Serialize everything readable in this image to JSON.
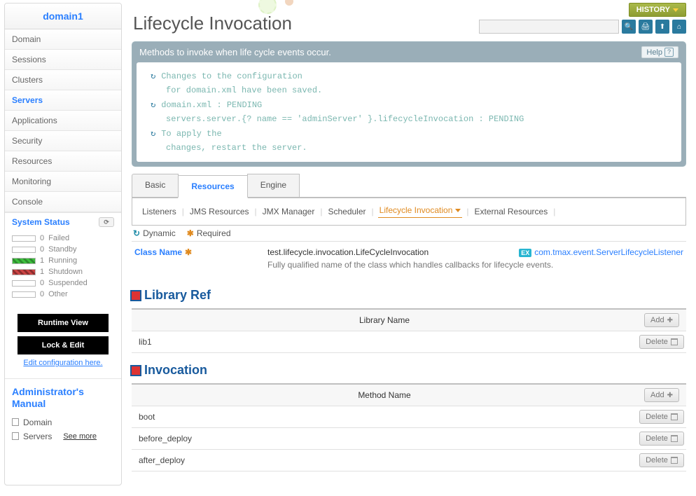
{
  "sidebar": {
    "title": "domain1",
    "items": [
      "Domain",
      "Sessions",
      "Clusters",
      "Servers",
      "Applications",
      "Security",
      "Resources",
      "Monitoring",
      "Console"
    ],
    "selectedIndex": 3,
    "systemStatusLabel": "System Status",
    "statuses": [
      {
        "count": "0",
        "label": "Failed",
        "swatch": ""
      },
      {
        "count": "0",
        "label": "Standby",
        "swatch": ""
      },
      {
        "count": "1",
        "label": "Running",
        "swatch": "green"
      },
      {
        "count": "1",
        "label": "Shutdown",
        "swatch": "red"
      },
      {
        "count": "0",
        "label": "Suspended",
        "swatch": ""
      },
      {
        "count": "0",
        "label": "Other",
        "swatch": ""
      }
    ],
    "runtimeBtn": "Runtime View",
    "lockBtn": "Lock & Edit",
    "editLink": "Edit configuration here.",
    "manualTitle": "Administrator's Manual",
    "manualItems": [
      "Domain",
      "Servers"
    ],
    "seeMore": "See more"
  },
  "header": {
    "historyBtn": "HISTORY",
    "pageTitle": "Lifecycle Invocation"
  },
  "messageBox": {
    "heading": "Methods to invoke when life cycle events occur.",
    "helpLabel": "Help",
    "lines": [
      "Changes to the configuration",
      "for domain.xml have been saved.",
      "domain.xml : PENDING",
      "servers.server.{? name == 'adminServer' }.lifecycleInvocation : PENDING",
      "To apply the",
      "changes, restart the server."
    ]
  },
  "tabs": {
    "main": [
      "Basic",
      "Resources",
      "Engine"
    ],
    "mainActive": 1,
    "sub": [
      "Listeners",
      "JMS Resources",
      "JMX Manager",
      "Scheduler",
      "Lifecycle Invocation",
      "External Resources"
    ],
    "subActive": 4
  },
  "indicators": {
    "dynamic": "Dynamic",
    "required": "Required"
  },
  "field": {
    "label": "Class Name",
    "value": "test.lifecycle.invocation.LifeCycleInvocation",
    "example": "com.tmax.event.ServerLifecycleListener",
    "desc": "Fully qualified name of the class which handles callbacks for lifecycle events."
  },
  "libraryRef": {
    "title": "Library Ref",
    "column": "Library Name",
    "rows": [
      "lib1"
    ]
  },
  "invocation": {
    "title": "Invocation",
    "column": "Method Name",
    "rows": [
      "boot",
      "before_deploy",
      "after_deploy"
    ]
  },
  "buttons": {
    "add": "Add",
    "delete": "Delete",
    "ex": "EX"
  }
}
